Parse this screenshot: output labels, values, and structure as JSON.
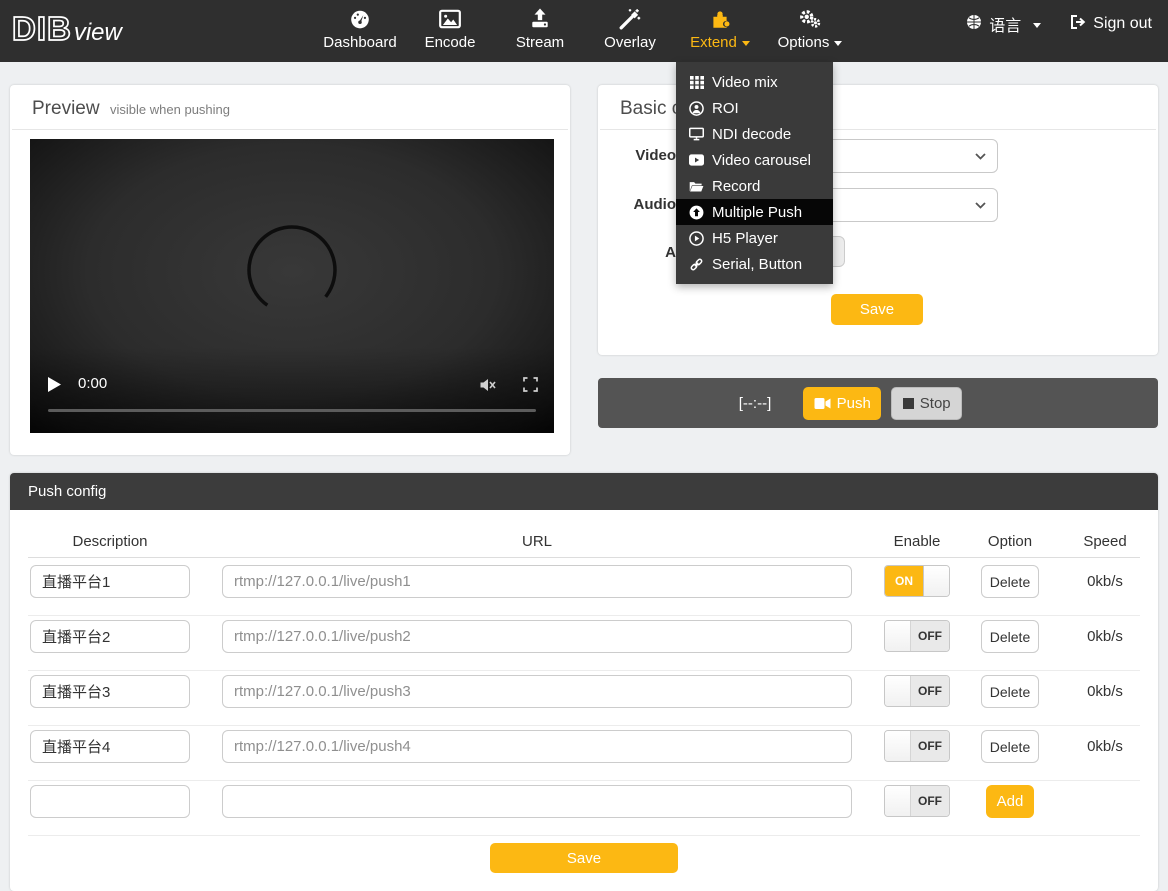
{
  "colors": {
    "accent": "#fcb813",
    "navbar_bg": "#2f2f2f",
    "menu_bg": "#3a3a3a",
    "menu_active_bg": "#060606",
    "pushbar_bg": "#545454",
    "page_bg": "#eef0f2"
  },
  "navbar": {
    "brand_bold": "DIB",
    "brand_light": "view",
    "items": [
      {
        "label": "Dashboard",
        "icon": "gauge-icon",
        "active": false
      },
      {
        "label": "Encode",
        "icon": "image-icon",
        "active": false
      },
      {
        "label": "Stream",
        "icon": "upload-icon",
        "active": false
      },
      {
        "label": "Overlay",
        "icon": "magic-wand-icon",
        "active": false
      },
      {
        "label": "Extend",
        "icon": "puzzle-icon",
        "active": true
      },
      {
        "label": "Options",
        "icon": "gears-icon",
        "active": false
      }
    ],
    "language_label": "语言",
    "signout_label": "Sign out"
  },
  "extend_menu": {
    "items": [
      {
        "label": "Video mix",
        "icon": "grid-icon",
        "active": false
      },
      {
        "label": "ROI",
        "icon": "user-circle-icon",
        "active": false
      },
      {
        "label": "NDI decode",
        "icon": "desktop-icon",
        "active": false
      },
      {
        "label": "Video carousel",
        "icon": "video-play-icon",
        "active": false
      },
      {
        "label": "Record",
        "icon": "folder-open-icon",
        "active": false
      },
      {
        "label": "Multiple Push",
        "icon": "arrow-circle-up-icon",
        "active": true
      },
      {
        "label": "H5 Player",
        "icon": "play-circle-icon",
        "active": false
      },
      {
        "label": "Serial, Button",
        "icon": "link-icon",
        "active": false
      }
    ]
  },
  "preview_panel": {
    "title": "Preview",
    "subtitle": "visible when pushing",
    "player_time": "0:00"
  },
  "basic_panel": {
    "title": "Basic config",
    "video_label": "Video",
    "audio_label": "Audio",
    "third_label": "A",
    "save_label": "Save"
  },
  "push_bar": {
    "timer": "[--:--]",
    "push_label": "Push",
    "stop_label": "Stop"
  },
  "push_config": {
    "title": "Push config",
    "columns": [
      "Description",
      "URL",
      "Enable",
      "Option",
      "Speed"
    ],
    "rows": [
      {
        "description": "直播平台1",
        "url_placeholder": "rtmp://127.0.0.1/live/push1",
        "toggle": "ON",
        "enabled": true,
        "option": "Delete",
        "speed": "0kb/s"
      },
      {
        "description": "直播平台2",
        "url_placeholder": "rtmp://127.0.0.1/live/push2",
        "toggle": "OFF",
        "enabled": false,
        "option": "Delete",
        "speed": "0kb/s"
      },
      {
        "description": "直播平台3",
        "url_placeholder": "rtmp://127.0.0.1/live/push3",
        "toggle": "OFF",
        "enabled": false,
        "option": "Delete",
        "speed": "0kb/s"
      },
      {
        "description": "直播平台4",
        "url_placeholder": "rtmp://127.0.0.1/live/push4",
        "toggle": "OFF",
        "enabled": false,
        "option": "Delete",
        "speed": "0kb/s"
      },
      {
        "description": "",
        "url_placeholder": "",
        "toggle": "OFF",
        "enabled": false,
        "option": "Add",
        "speed": ""
      }
    ],
    "save_label": "Save"
  }
}
